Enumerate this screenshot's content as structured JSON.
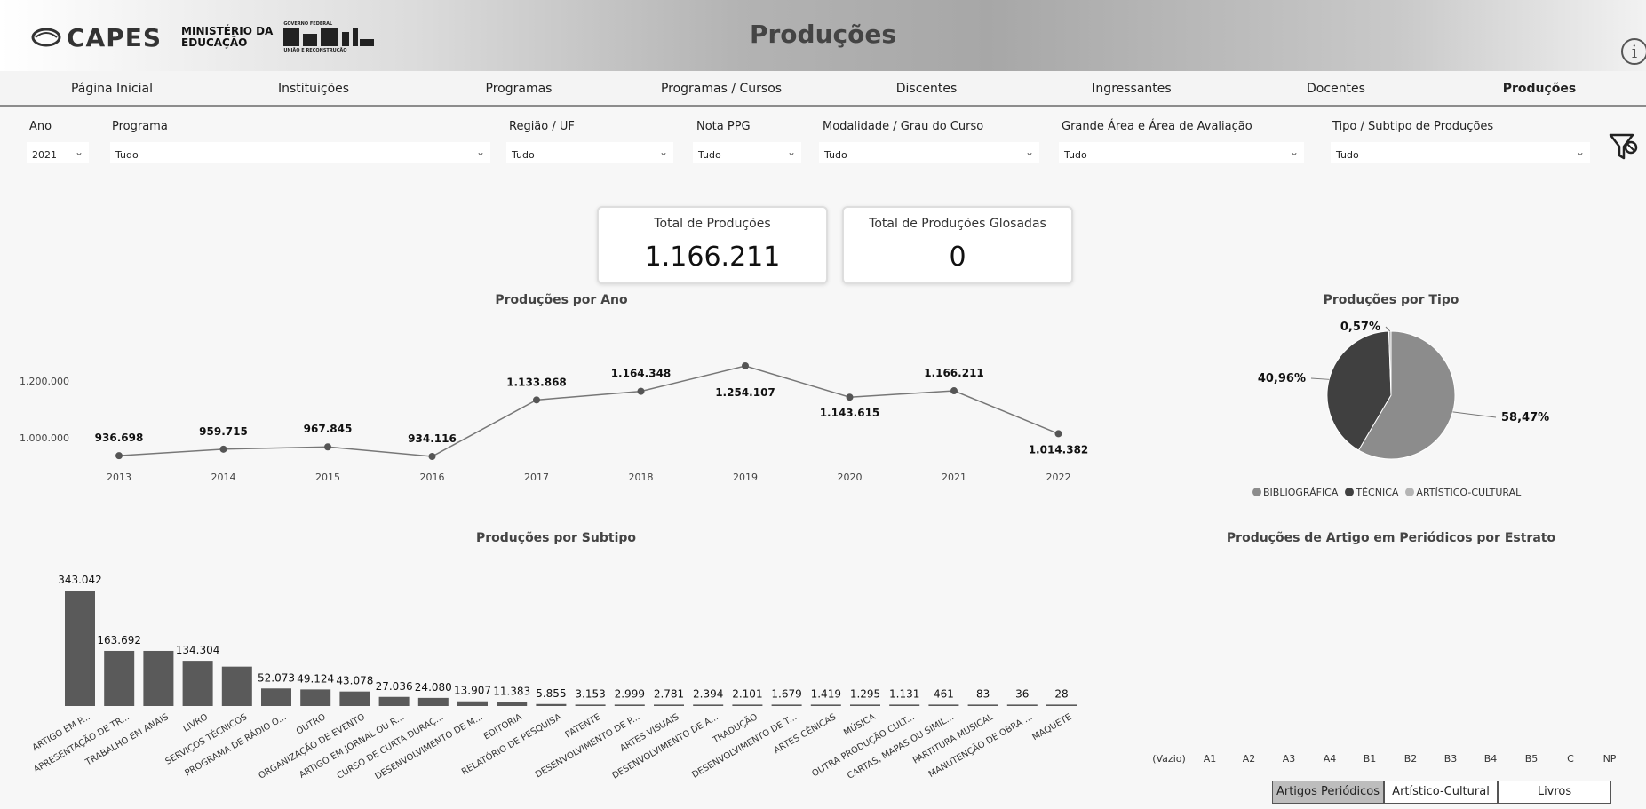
{
  "header": {
    "logo_text": "CAPES",
    "ministerio_line1": "MINISTÉRIO DA",
    "ministerio_line2": "EDUCAÇÃO",
    "gov_line1": "GOVERNO FEDERAL",
    "gov_line2": "UNIÃO E RECONSTRUÇÃO",
    "title": "Produções",
    "info_icon": "info-icon"
  },
  "nav": {
    "items": [
      "Página Inicial",
      "Instituições",
      "Programas",
      "Programas / Cursos",
      "Discentes",
      "Ingressantes",
      "Docentes",
      "Produções"
    ],
    "active": "Produções"
  },
  "filters": {
    "ano": {
      "label": "Ano",
      "value": "2021"
    },
    "programa": {
      "label": "Programa",
      "value": "Tudo"
    },
    "regiao": {
      "label": "Região / UF",
      "value": "Tudo"
    },
    "nota": {
      "label": "Nota PPG",
      "value": "Tudo"
    },
    "modalidade": {
      "label": "Modalidade / Grau do Curso",
      "value": "Tudo"
    },
    "area": {
      "label": "Grande Área e Área de Avaliação",
      "value": "Tudo"
    },
    "tipo": {
      "label": "Tipo / Subtipo de Produções",
      "value": "Tudo"
    },
    "clear_icon": "filter-clear-icon"
  },
  "cards": {
    "total": {
      "label": "Total de Produções",
      "value": "1.166.211"
    },
    "glosadas": {
      "label": "Total de Produções Glosadas",
      "value": "0"
    }
  },
  "chart_data": [
    {
      "type": "line",
      "title": "Produções por Ano",
      "x": [
        "2013",
        "2014",
        "2015",
        "2016",
        "2017",
        "2018",
        "2019",
        "2020",
        "2021",
        "2022"
      ],
      "values": [
        936698,
        959715,
        967845,
        934116,
        1133868,
        1164348,
        1254107,
        1143615,
        1166211,
        1014382
      ],
      "labels": [
        "936.698",
        "959.715",
        "967.845",
        "934.116",
        "1.133.868",
        "1.164.348",
        "1.254.107",
        "1.143.615",
        "1.166.211",
        "1.014.382"
      ],
      "yticks": [
        {
          "value": 1000000,
          "label": "1.000.000"
        },
        {
          "value": 1200000,
          "label": "1.200.000"
        }
      ],
      "color": "#777777"
    },
    {
      "type": "pie",
      "title": "Produções por Tipo",
      "slices": [
        {
          "name": "BIBLIOGRÁFICA",
          "value": 58.47,
          "label": "58,47%",
          "color": "#8c8c8c"
        },
        {
          "name": "TÉCNICA",
          "value": 40.96,
          "label": "40,96%",
          "color": "#404040"
        },
        {
          "name": "ARTÍSTICO-CULTURAL",
          "value": 0.57,
          "label": "0,57%",
          "color": "#b5b5b5"
        }
      ],
      "legend_position": "bottom"
    },
    {
      "type": "bar",
      "title": "Produções por Subtipo",
      "categories": [
        "ARTIGO EM P...",
        "APRESENTAÇÃO DE TR...",
        "TRABALHO EM ANAIS",
        "LIVRO",
        "SERVIÇOS TÉCNICOS",
        "PROGRAMA DE RÁDIO O...",
        "OUTRO",
        "ORGANIZAÇÃO DE EVENTO",
        "ARTIGO EM JORNAL OU R...",
        "CURSO DE CURTA DURAÇ...",
        "DESENVOLVIMENTO DE M...",
        "EDITORIA",
        "RELATÓRIO DE PESQUISA",
        "PATENTE",
        "DESENVOLVIMENTO DE P...",
        "ARTES VISUAIS",
        "DESENVOLVIMENTO DE A...",
        "TRADUÇÃO",
        "DESENVOLVIMENTO DE T...",
        "ARTES CÊNICAS",
        "MÚSICA",
        "OUTRA PRODUÇÃO CULT...",
        "CARTAS, MAPAS OU SIMIL...",
        "PARTITURA MUSICAL",
        "MANUTENÇÃO DE OBRA ...",
        "MAQUETE"
      ],
      "values": [
        343042,
        163692,
        163692,
        134304,
        117000,
        52073,
        49124,
        43078,
        27036,
        24080,
        13907,
        11383,
        5855,
        3153,
        2999,
        2781,
        2394,
        2101,
        1679,
        1419,
        1295,
        1131,
        461,
        83,
        36,
        28
      ],
      "labels": [
        "343.042",
        "163.692",
        "",
        "134.304",
        "",
        "52.073",
        "49.124",
        "43.078",
        "27.036",
        "24.080",
        "13.907",
        "11.383",
        "5.855",
        "3.153",
        "2.999",
        "2.781",
        "2.394",
        "2.101",
        "1.679",
        "1.419",
        "1.295",
        "1.131",
        "461",
        "83",
        "36",
        "28"
      ],
      "color": "#5a5a5a"
    },
    {
      "type": "bar",
      "title": "Produções de Artigo em Periódicos por Estrato",
      "categories": [
        "(Vazio)",
        "A1",
        "A2",
        "A3",
        "A4",
        "B1",
        "B2",
        "B3",
        "B4",
        "B5",
        "C",
        "NP"
      ],
      "values": []
    }
  ],
  "strata_toggle": {
    "options": [
      "Artigos Periódicos",
      "Artístico-Cultural",
      "Livros"
    ],
    "selected": "Artigos Periódicos"
  }
}
